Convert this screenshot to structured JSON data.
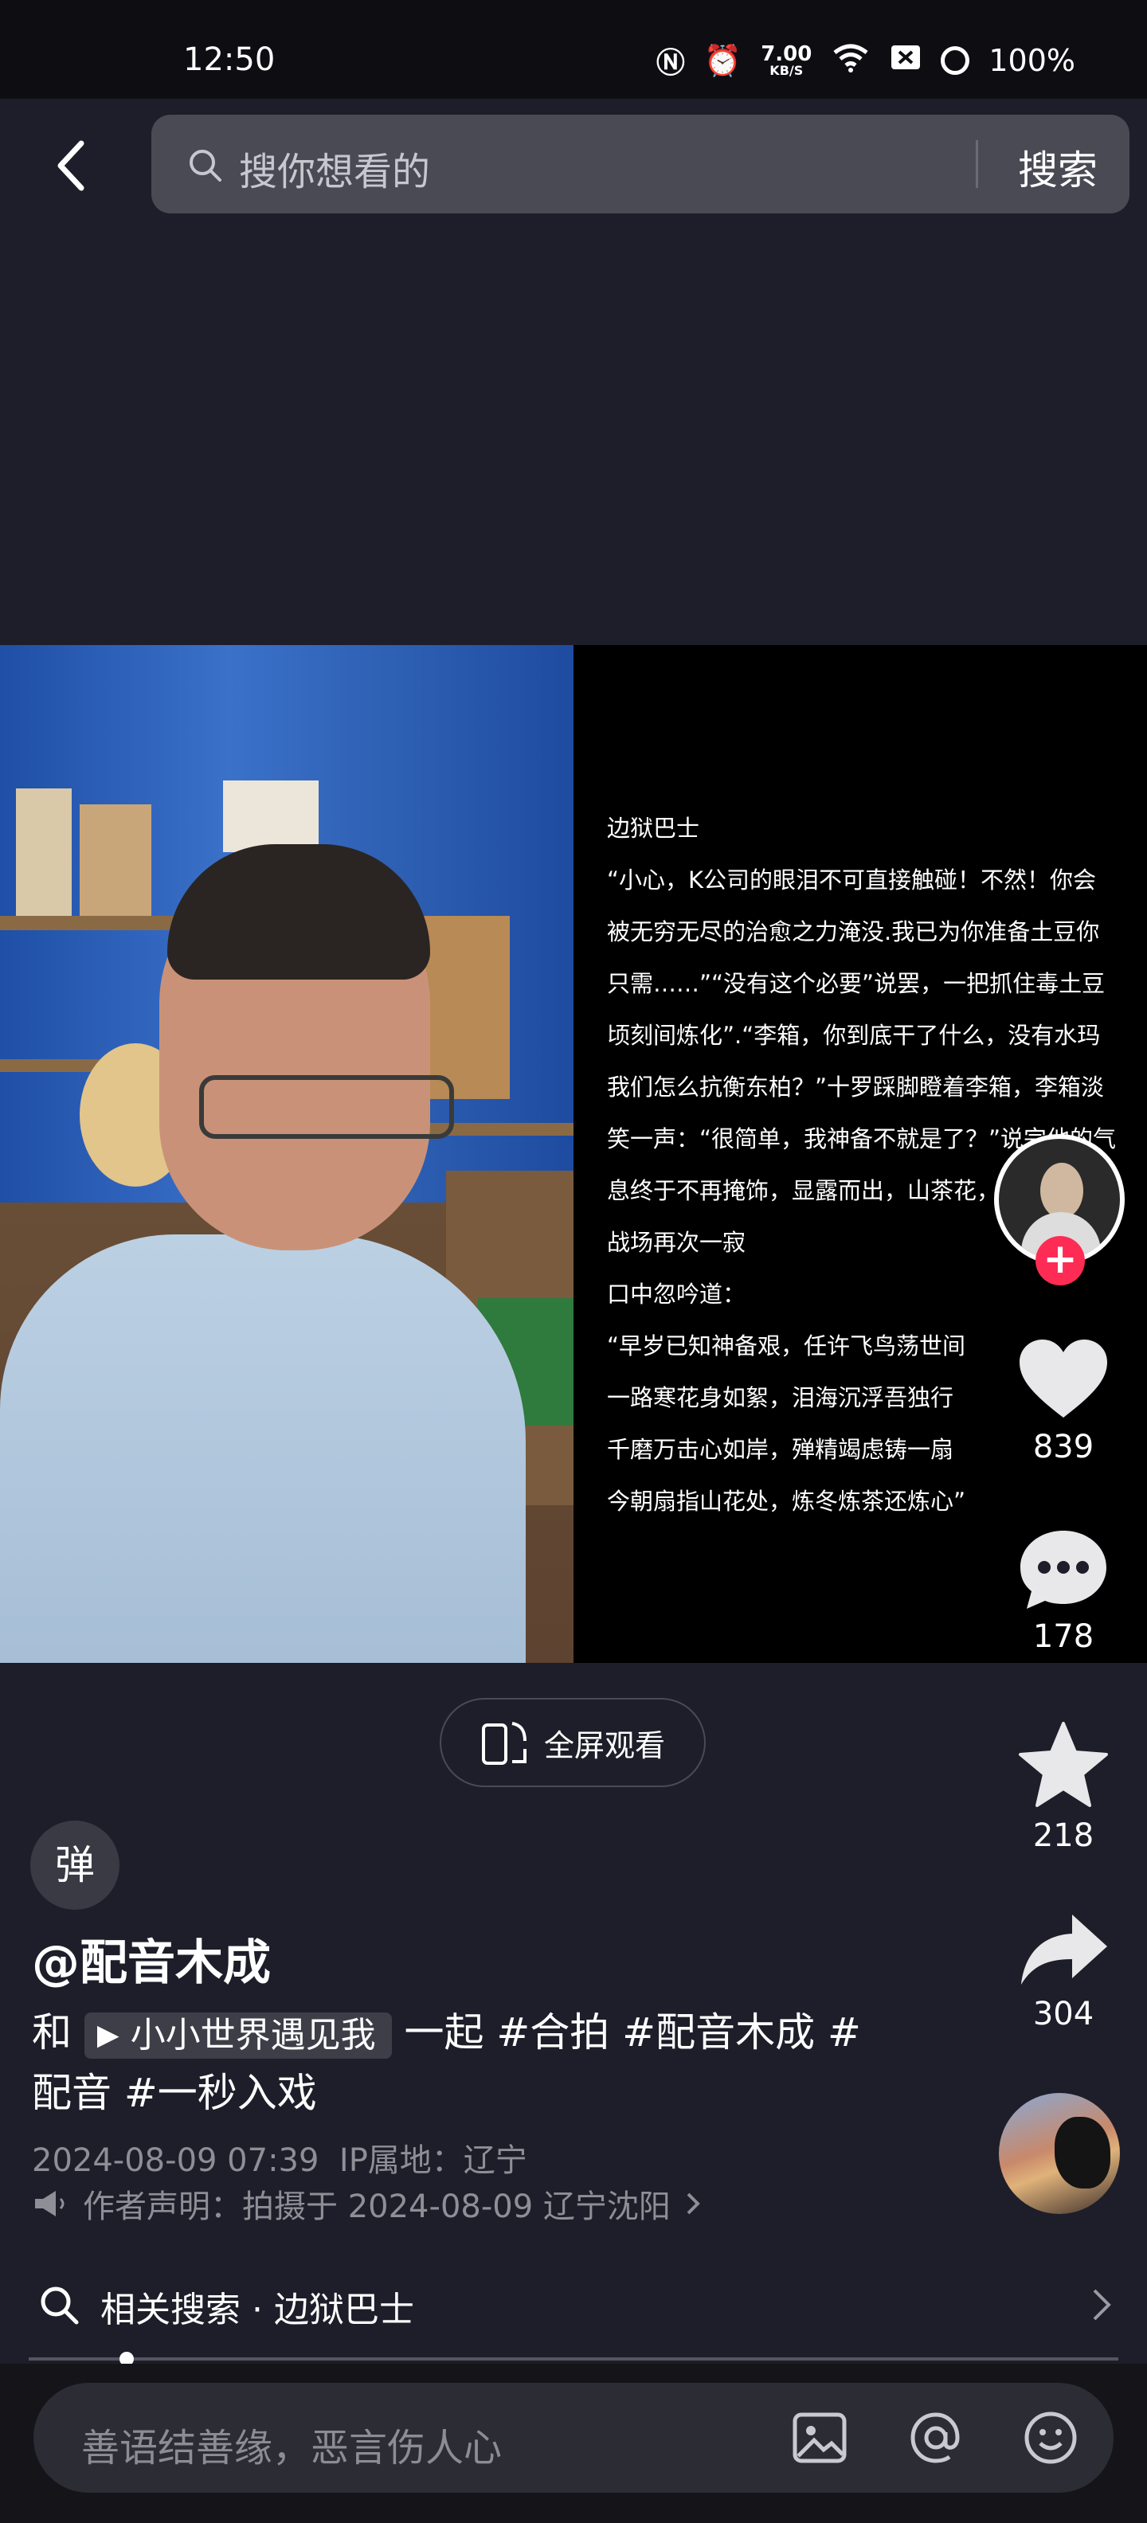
{
  "status_bar": {
    "time": "12:50",
    "net_speed_value": "7.00",
    "net_speed_unit": "KB/S",
    "battery": "100%"
  },
  "search": {
    "placeholder": "搜你想看的",
    "button_label": "搜索"
  },
  "video": {
    "lyrics_title": "边狱巴士",
    "lyrics_lines": [
      "“小心，K公司的眼泪不可直接触碰！不然！你会",
      "被无穷无尽的治愈之力淹没.我已为你准备土豆你",
      "只需……”“没有这个必要”说罢，一把抓住毒土豆",
      "顷刻间炼化”.“李箱，你到底干了什么，没有水玛",
      "我们怎么抗衡东柏？”十罗踩脚瞪着李箱，李箱淡",
      "笑一声：“很简单，我神备不就是了？”说完他的气",
      "息终于不再掩饰，显露而出，山茶花，一瞬间",
      "战场再次一寂",
      "口中忽吟道：",
      "“早岁已知神备艰，任许飞鸟荡世间",
      "一路寒花身如絮，泪海沉浮吾独行",
      "千磨万击心如岸，殚精竭虑铸一扇",
      "今朝扇指山花处，炼冬炼茶还炼心”"
    ]
  },
  "actions": {
    "follow": "+",
    "likes": "839",
    "comments": "178",
    "favorites": "218",
    "shares": "304"
  },
  "fullscreen_label": "全屏观看",
  "danmu_label": "弹",
  "post": {
    "author": "@配音木成",
    "caption_prefix": "和",
    "collab_chip": "小小世界遇见我",
    "caption_line1_rest": "一起 #合拍 #配音木成 #",
    "caption_line2": "配音 #一秒入戏",
    "date": "2024-08-09 07:39",
    "ip": "IP属地：辽宁",
    "declaration": "作者声明：拍摄于 2024-08-09 辽宁沈阳"
  },
  "related_search": "相关搜索 · 边狱巴士",
  "progress_fraction": 0.09,
  "comment_placeholder": "善语结善缘，恶言伤人心"
}
